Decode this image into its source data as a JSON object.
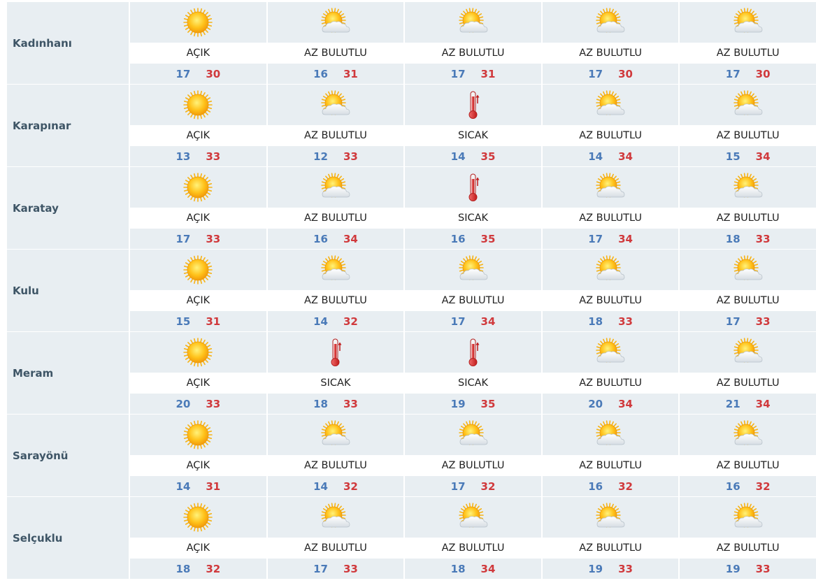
{
  "colors": {
    "cell_bg": "#e8eef2",
    "city_text": "#3e5566",
    "min_temp": "#4a7ab8",
    "max_temp": "#d0393c"
  },
  "cities": [
    {
      "name": "Kadınhanı",
      "days": [
        {
          "icon": "sun-icon",
          "condition": "AÇIK",
          "min": "17",
          "max": "30"
        },
        {
          "icon": "partly-cloudy-icon",
          "condition": "AZ BULUTLU",
          "min": "16",
          "max": "31"
        },
        {
          "icon": "partly-cloudy-icon",
          "condition": "AZ BULUTLU",
          "min": "17",
          "max": "31"
        },
        {
          "icon": "partly-cloudy-icon",
          "condition": "AZ BULUTLU",
          "min": "17",
          "max": "30"
        },
        {
          "icon": "partly-cloudy-icon",
          "condition": "AZ BULUTLU",
          "min": "17",
          "max": "30"
        }
      ]
    },
    {
      "name": "Karapınar",
      "days": [
        {
          "icon": "sun-icon",
          "condition": "AÇIK",
          "min": "13",
          "max": "33"
        },
        {
          "icon": "partly-cloudy-icon",
          "condition": "AZ BULUTLU",
          "min": "12",
          "max": "33"
        },
        {
          "icon": "thermometer-icon",
          "condition": "SICAK",
          "min": "14",
          "max": "35"
        },
        {
          "icon": "partly-cloudy-icon",
          "condition": "AZ BULUTLU",
          "min": "14",
          "max": "34"
        },
        {
          "icon": "partly-cloudy-icon",
          "condition": "AZ BULUTLU",
          "min": "15",
          "max": "34"
        }
      ]
    },
    {
      "name": "Karatay",
      "days": [
        {
          "icon": "sun-icon",
          "condition": "AÇIK",
          "min": "17",
          "max": "33"
        },
        {
          "icon": "partly-cloudy-icon",
          "condition": "AZ BULUTLU",
          "min": "16",
          "max": "34"
        },
        {
          "icon": "thermometer-icon",
          "condition": "SICAK",
          "min": "16",
          "max": "35"
        },
        {
          "icon": "partly-cloudy-icon",
          "condition": "AZ BULUTLU",
          "min": "17",
          "max": "34"
        },
        {
          "icon": "partly-cloudy-icon",
          "condition": "AZ BULUTLU",
          "min": "18",
          "max": "33"
        }
      ]
    },
    {
      "name": "Kulu",
      "days": [
        {
          "icon": "sun-icon",
          "condition": "AÇIK",
          "min": "15",
          "max": "31"
        },
        {
          "icon": "partly-cloudy-icon",
          "condition": "AZ BULUTLU",
          "min": "14",
          "max": "32"
        },
        {
          "icon": "partly-cloudy-icon",
          "condition": "AZ BULUTLU",
          "min": "17",
          "max": "34"
        },
        {
          "icon": "partly-cloudy-icon",
          "condition": "AZ BULUTLU",
          "min": "18",
          "max": "33"
        },
        {
          "icon": "partly-cloudy-icon",
          "condition": "AZ BULUTLU",
          "min": "17",
          "max": "33"
        }
      ]
    },
    {
      "name": "Meram",
      "days": [
        {
          "icon": "sun-icon",
          "condition": "AÇIK",
          "min": "20",
          "max": "33"
        },
        {
          "icon": "thermometer-icon",
          "condition": "SICAK",
          "min": "18",
          "max": "33"
        },
        {
          "icon": "thermometer-icon",
          "condition": "SICAK",
          "min": "19",
          "max": "35"
        },
        {
          "icon": "partly-cloudy-icon",
          "condition": "AZ BULUTLU",
          "min": "20",
          "max": "34"
        },
        {
          "icon": "partly-cloudy-icon",
          "condition": "AZ BULUTLU",
          "min": "21",
          "max": "34"
        }
      ]
    },
    {
      "name": "Sarayönü",
      "days": [
        {
          "icon": "sun-icon",
          "condition": "AÇIK",
          "min": "14",
          "max": "31"
        },
        {
          "icon": "partly-cloudy-icon",
          "condition": "AZ BULUTLU",
          "min": "14",
          "max": "32"
        },
        {
          "icon": "partly-cloudy-icon",
          "condition": "AZ BULUTLU",
          "min": "17",
          "max": "32"
        },
        {
          "icon": "partly-cloudy-icon",
          "condition": "AZ BULUTLU",
          "min": "16",
          "max": "32"
        },
        {
          "icon": "partly-cloudy-icon",
          "condition": "AZ BULUTLU",
          "min": "16",
          "max": "32"
        }
      ]
    },
    {
      "name": "Selçuklu",
      "days": [
        {
          "icon": "sun-icon",
          "condition": "AÇIK",
          "min": "18",
          "max": "32"
        },
        {
          "icon": "partly-cloudy-icon",
          "condition": "AZ BULUTLU",
          "min": "17",
          "max": "33"
        },
        {
          "icon": "partly-cloudy-icon",
          "condition": "AZ BULUTLU",
          "min": "18",
          "max": "34"
        },
        {
          "icon": "partly-cloudy-icon",
          "condition": "AZ BULUTLU",
          "min": "19",
          "max": "33"
        },
        {
          "icon": "partly-cloudy-icon",
          "condition": "AZ BULUTLU",
          "min": "19",
          "max": "33"
        }
      ]
    }
  ]
}
